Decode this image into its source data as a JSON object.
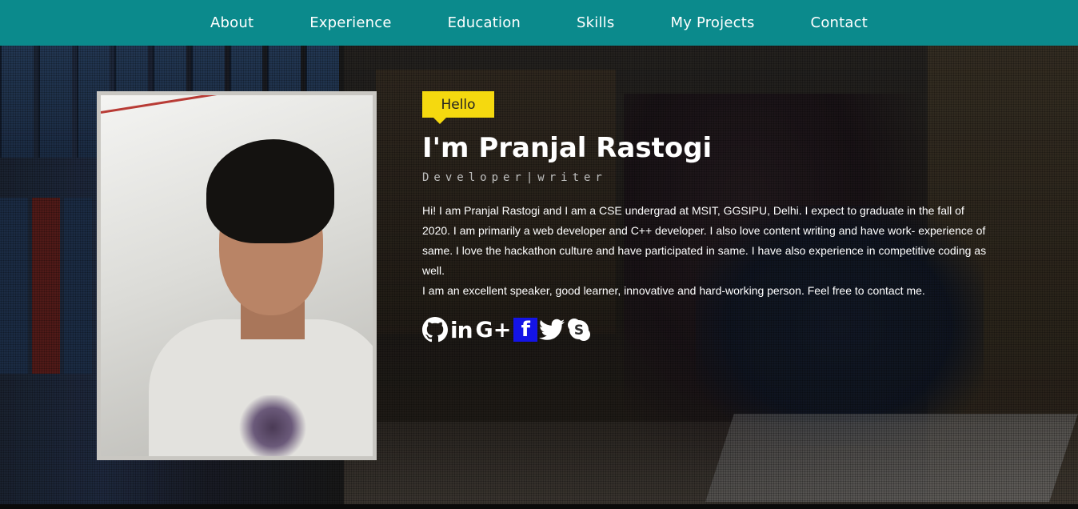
{
  "nav": {
    "items": [
      "About",
      "Experience",
      "Education",
      "Skills",
      "My Projects",
      "Contact"
    ]
  },
  "hero": {
    "greeting": "Hello",
    "name": "I'm Pranjal Rastogi",
    "role": "Developer|writer",
    "bio_lines": [
      "Hi! I am Pranjal Rastogi and I am a CSE undergrad at MSIT, GGSIPU, Delhi. I expect to graduate in the fall of 2020. I am primarily a web developer and C++ developer. I also love content writing and have work- experience of same. I love the hackathon culture and have participated in same. I have also experience in competitive coding as well.",
      "I am an excellent speaker, good learner, innovative and hard-working person. Feel free to contact me."
    ],
    "socials": {
      "github_icon": "github-icon",
      "linkedin_text": "in",
      "googleplus_text": "G+",
      "facebook_text": "f",
      "twitter_icon": "twitter-icon",
      "skype_icon": "skype-icon"
    }
  },
  "colors": {
    "nav_bg": "#0b8a8c",
    "hello_badge": "#f5d90f",
    "facebook_bg": "#1414e6"
  }
}
